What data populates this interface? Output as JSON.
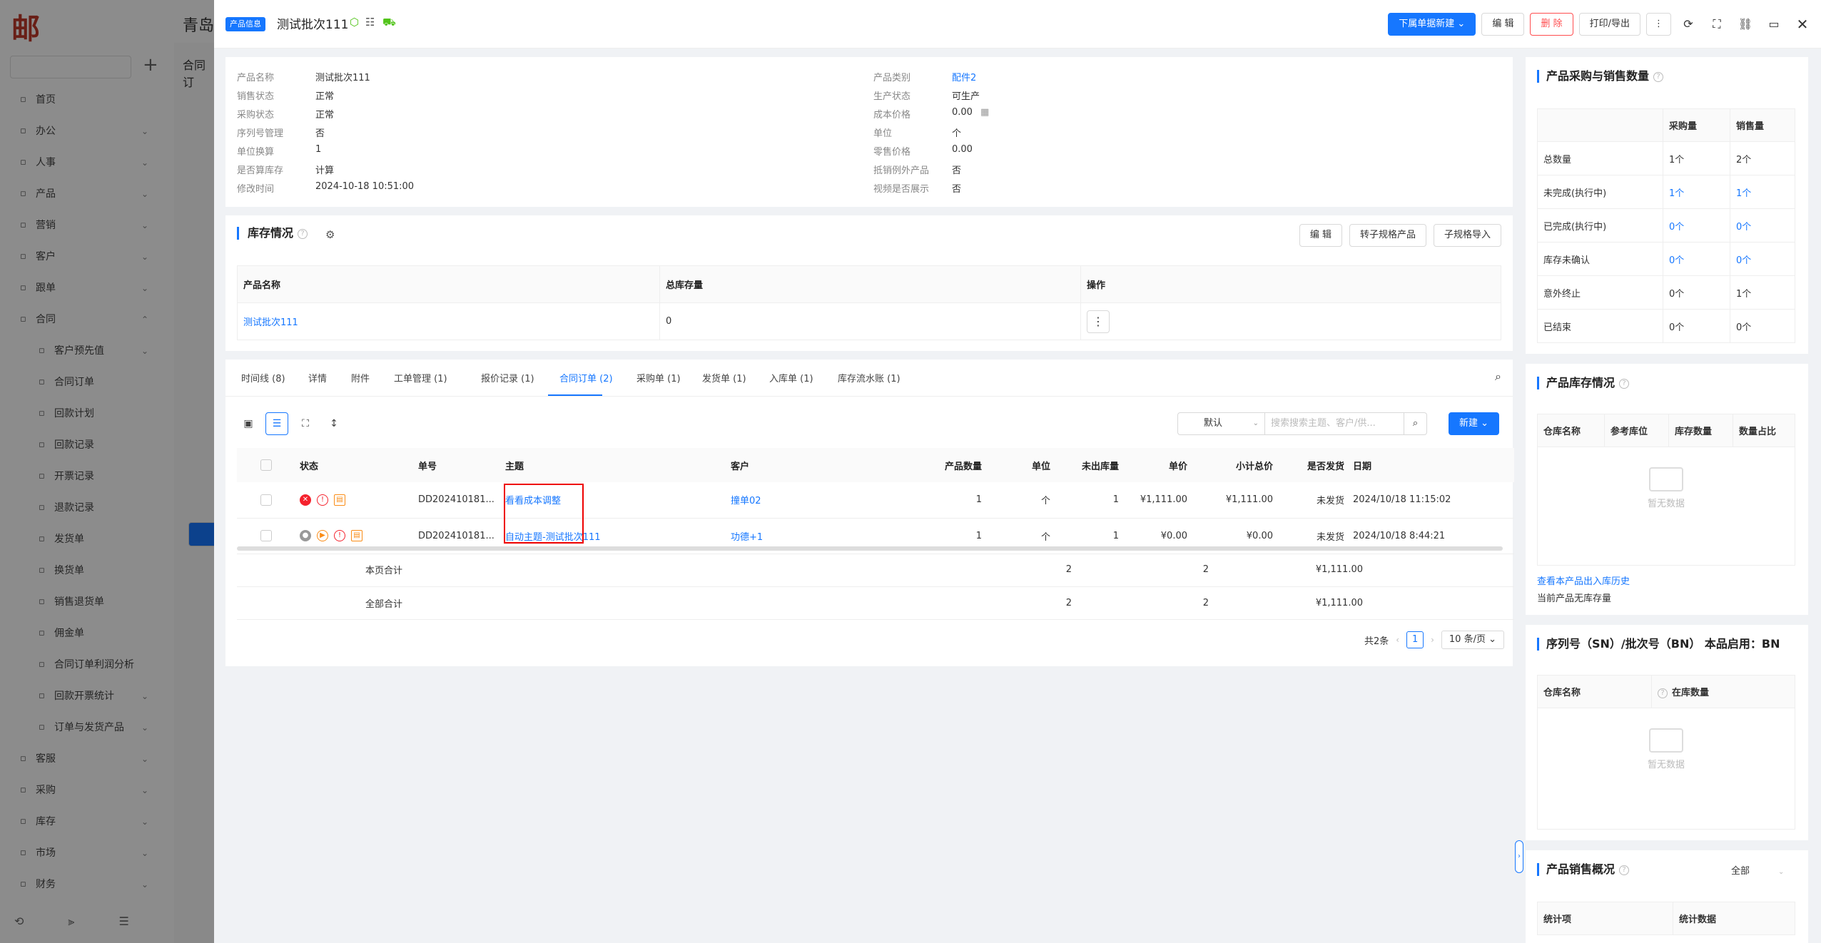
{
  "background_app": {
    "logo": "邮",
    "top_title": "青岛",
    "search_placeholder": "",
    "plus": "+",
    "col2_text": "合同订",
    "menu": [
      {
        "label": "首页",
        "sub": false,
        "chev": ""
      },
      {
        "label": "办公",
        "sub": false,
        "chev": "⌄"
      },
      {
        "label": "人事",
        "sub": false,
        "chev": "⌄"
      },
      {
        "label": "产品",
        "sub": false,
        "chev": "⌄"
      },
      {
        "label": "营销",
        "sub": false,
        "chev": "⌄"
      },
      {
        "label": "客户",
        "sub": false,
        "chev": "⌄"
      },
      {
        "label": "跟单",
        "sub": false,
        "chev": "⌄"
      },
      {
        "label": "合同",
        "sub": false,
        "chev": "⌃"
      },
      {
        "label": "客户预先值",
        "sub": true,
        "chev": "⌄"
      },
      {
        "label": "合同订单",
        "sub": true,
        "chev": ""
      },
      {
        "label": "回款计划",
        "sub": true,
        "chev": ""
      },
      {
        "label": "回款记录",
        "sub": true,
        "chev": ""
      },
      {
        "label": "开票记录",
        "sub": true,
        "chev": ""
      },
      {
        "label": "退款记录",
        "sub": true,
        "chev": ""
      },
      {
        "label": "发货单",
        "sub": true,
        "chev": ""
      },
      {
        "label": "换货单",
        "sub": true,
        "chev": ""
      },
      {
        "label": "销售退货单",
        "sub": true,
        "chev": ""
      },
      {
        "label": "佣金单",
        "sub": true,
        "chev": ""
      },
      {
        "label": "合同订单利润分析",
        "sub": true,
        "chev": ""
      },
      {
        "label": "回款开票统计",
        "sub": true,
        "chev": "⌄"
      },
      {
        "label": "订单与发货产品",
        "sub": true,
        "chev": "⌄"
      },
      {
        "label": "客服",
        "sub": false,
        "chev": "⌄"
      },
      {
        "label": "采购",
        "sub": false,
        "chev": "⌄"
      },
      {
        "label": "库存",
        "sub": false,
        "chev": "⌄"
      },
      {
        "label": "市场",
        "sub": false,
        "chev": "⌄"
      },
      {
        "label": "财务",
        "sub": false,
        "chev": "⌄"
      }
    ]
  },
  "header": {
    "tag": "产品信息",
    "title": "测试批次111",
    "icons": [
      "cube-icon",
      "list-icon",
      "truck-icon"
    ],
    "actions": {
      "new_from": "下属单据新建",
      "edit": "编 辑",
      "delete": "删 除",
      "print_export": "打印/导出",
      "more": "⋮"
    }
  },
  "info": {
    "left": [
      {
        "label": "产品名称",
        "value": "测试批次111"
      },
      {
        "label": "销售状态",
        "value": "正常"
      },
      {
        "label": "采购状态",
        "value": "正常"
      },
      {
        "label": "序列号管理",
        "value": "否"
      },
      {
        "label": "单位换算",
        "value": "1"
      },
      {
        "label": "是否算库存",
        "value": "计算"
      },
      {
        "label": "修改时间",
        "value": "2024-10-18 10:51:00"
      }
    ],
    "right": [
      {
        "label": "产品类别",
        "value": "配件2"
      },
      {
        "label": "生产状态",
        "value": "可生产"
      },
      {
        "label": "成本价格",
        "value": "0.00"
      },
      {
        "label": "单位",
        "value": "个"
      },
      {
        "label": "零售价格",
        "value": "0.00"
      },
      {
        "label": "抵销例外产品",
        "value": "否"
      },
      {
        "label": "视频是否展示",
        "value": "否"
      }
    ]
  },
  "stock": {
    "title": "库存情况",
    "buttons": {
      "edit": "编 辑",
      "convert": "转子规格产品",
      "import": "子规格导入"
    },
    "columns": [
      "产品名称",
      "总库存量",
      "操作"
    ],
    "row": {
      "name": "测试批次111",
      "total": "0",
      "action": "⋮"
    }
  },
  "tabs": [
    {
      "label": "时间线 (8)"
    },
    {
      "label": "详情"
    },
    {
      "label": "附件"
    },
    {
      "label": "工单管理 (1)"
    },
    {
      "label": "报价记录 (1)"
    },
    {
      "label": "合同订单 (2)"
    },
    {
      "label": "采购单 (1)"
    },
    {
      "label": "发货单 (1)"
    },
    {
      "label": "入库单 (1)"
    },
    {
      "label": "库存流水账 (1)"
    }
  ],
  "orders": {
    "filter_default": "默认",
    "search_placeholder": "搜索搜索主题、客户/供...",
    "new_button": "新建",
    "columns": {
      "status": "状态",
      "number": "单号",
      "subject": "主题",
      "customer": "客户",
      "qty": "产品数量",
      "unit": "单位",
      "unshipped": "未出库量",
      "price": "单价",
      "subtotal": "小计总价",
      "shipped": "是否发货",
      "date": "日期"
    },
    "rows": [
      {
        "number": "DD202410181...",
        "subject": "看看成本调整",
        "customer": "撞单02",
        "qty": "1",
        "unit": "个",
        "unshipped": "1",
        "price": "¥1,111.00",
        "subtotal": "¥1,111.00",
        "shipped": "未发货",
        "date": "2024/10/18 11:15:02"
      },
      {
        "number": "DD202410181...",
        "subject": "自动主题-测试批次111",
        "customer": "功德+1",
        "qty": "1",
        "unit": "个",
        "unshipped": "1",
        "price": "¥0.00",
        "subtotal": "¥0.00",
        "shipped": "未发货",
        "date": "2024/10/18 8:44:21"
      }
    ],
    "sums": [
      {
        "label": "本页合计",
        "qty": "2",
        "unshipped": "2",
        "subtotal": "¥1,111.00"
      },
      {
        "label": "全部合计",
        "qty": "2",
        "unshipped": "2",
        "subtotal": "¥1,111.00"
      }
    ],
    "pager": {
      "total": "共2条",
      "page": "1",
      "size": "10 条/页"
    }
  },
  "side": {
    "purchase_sales": {
      "title": "产品采购与销售数量",
      "columns": [
        "",
        "采购量",
        "销售量"
      ],
      "rows": [
        {
          "label": "总数量",
          "purchase": "1个",
          "sales": "2个",
          "link": false
        },
        {
          "label": "未完成(执行中)",
          "purchase": "1个",
          "sales": "1个",
          "link": true
        },
        {
          "label": "已完成(执行中)",
          "purchase": "0个",
          "sales": "0个",
          "link": true
        },
        {
          "label": "库存未确认",
          "purchase": "0个",
          "sales": "0个",
          "link": true
        },
        {
          "label": "意外终止",
          "purchase": "0个",
          "sales": "1个",
          "link": false
        },
        {
          "label": "已结束",
          "purchase": "0个",
          "sales": "0个",
          "link": false
        }
      ]
    },
    "inventory": {
      "title": "产品库存情况",
      "columns": [
        "仓库名称",
        "参考库位",
        "库存数量",
        "数量占比"
      ],
      "empty": "暂无数据",
      "link": "查看本产品出入库历史",
      "note": "当前产品无库存量"
    },
    "serial": {
      "title": "序列号（SN）/批次号（BN）  本品启用：BN",
      "columns": [
        "仓库名称",
        "在库数量"
      ],
      "empty": "暂无数据"
    },
    "sales_overview": {
      "title": "产品销售概况",
      "select": "全部",
      "columns": [
        "统计项",
        "统计数据"
      ]
    }
  }
}
